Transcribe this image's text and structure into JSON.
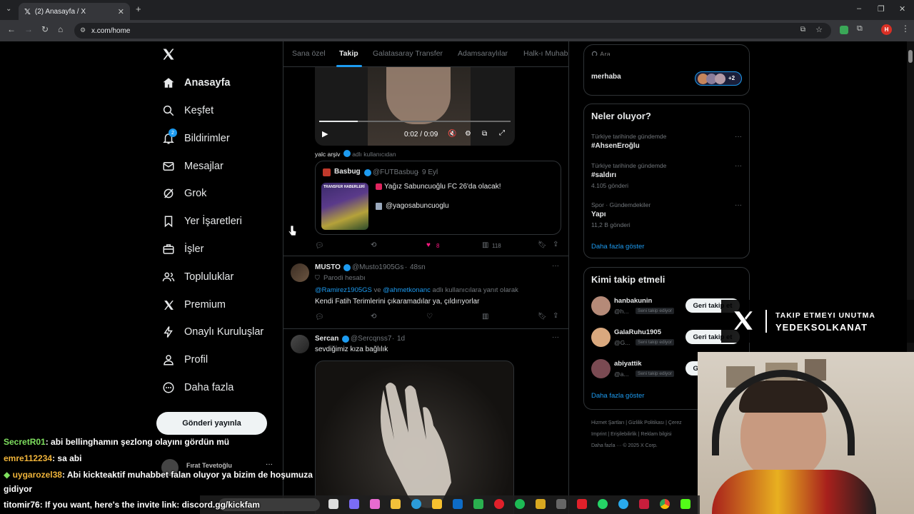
{
  "browser": {
    "tab_title": "(2) Anasayfa / X",
    "url": "x.com/home",
    "profile_initial": "H"
  },
  "nav": {
    "items": [
      {
        "label": "Anasayfa",
        "icon": "home-icon"
      },
      {
        "label": "Keşfet",
        "icon": "search-icon"
      },
      {
        "label": "Bildirimler",
        "icon": "bell-icon",
        "badge": "2"
      },
      {
        "label": "Mesajlar",
        "icon": "mail-icon"
      },
      {
        "label": "Grok",
        "icon": "grok-icon"
      },
      {
        "label": "Yer İşaretleri",
        "icon": "bookmark-icon"
      },
      {
        "label": "İşler",
        "icon": "briefcase-icon"
      },
      {
        "label": "Topluluklar",
        "icon": "people-icon"
      },
      {
        "label": "Premium",
        "icon": "x-logo-icon"
      },
      {
        "label": "Onaylı Kuruluşlar",
        "icon": "lightning-icon"
      },
      {
        "label": "Profil",
        "icon": "person-icon"
      },
      {
        "label": "Daha fazla",
        "icon": "more-circle-icon"
      }
    ],
    "post_button": "Gönderi yayınla",
    "account_name": "Fırat Tevetoğlu"
  },
  "tabs": [
    "Sana özel",
    "Takip",
    "Galatasaray Transfer",
    "Adamsaraylılar",
    "Halk-ı Muhab"
  ],
  "video": {
    "time": "0:02 / 0:09",
    "progress": 0.2
  },
  "repost_line": {
    "name": "yalc arşiv",
    "suffix": "adlı kullanıcıdan"
  },
  "quote": {
    "name": "Basbug",
    "handle": "@FUTBasbug",
    "date": "9 Eyl",
    "line1": "Yağız Sabuncuoğlu FC 26'da olacak!",
    "line2": "@yagosabuncuoglu",
    "thumb_label": "TRANSFER HABERLERİ"
  },
  "tweet1_actions": {
    "likes": "8",
    "views": "118"
  },
  "tweet2": {
    "name": "MUSTO",
    "handle": "@Musto1905Gs",
    "time": "48sn",
    "parody": "Parodi hesabı",
    "reply_to_1": "@Ramirez1905GS",
    "reply_and": "ve",
    "reply_to_2": "@ahmetkonanc",
    "reply_suffix": "adlı kullanıcılara yanıt olarak",
    "text": "Kendi Fatih Terimlerini çıkaramadılar ya, çıldırıyorlar"
  },
  "tweet3": {
    "name": "Sercan",
    "handle": "@Sercqnss7",
    "time": "1d",
    "text": "sevdiğimiz kıza bağlılık"
  },
  "right": {
    "search_placeholder": "Ara",
    "top_snippet": "merhaba",
    "top_badge": "+2",
    "trends_title": "Neler oluyor?",
    "trends": [
      {
        "category": "Türkiye tarihinde gündemde",
        "name": "#AhsenEroğlu",
        "count": ""
      },
      {
        "category": "Türkiye tarihinde gündemde",
        "name": "#saldırı",
        "count": "4.105 gönderi"
      },
      {
        "category": "Spor · Gündemdekiler",
        "name": "Yapı",
        "count": "11,2 B gönderi"
      }
    ],
    "show_more": "Daha fazla göster",
    "who_title": "Kimi takip etmeli",
    "who": [
      {
        "name": "hanbakunin",
        "handle": "@h...",
        "follows_you": "Seni takip ediyor",
        "button": "Geri takip et"
      },
      {
        "name": "GalaRuhu1905",
        "handle": "@G...",
        "follows_you": "Seni takip ediyor",
        "button": "Geri takip et"
      },
      {
        "name": "abiyattik",
        "handle": "@a...",
        "follows_you": "Seni takip ediyor",
        "button": "Geri takip et"
      }
    ],
    "who_show_more": "Daha fazla göster",
    "footer": {
      "line1": [
        "Hizmet Şartları",
        "Gizlilik Politikası",
        "Çerez"
      ],
      "line2": [
        "Imprint",
        "Erişilebilirlik",
        "Reklam bilgisi"
      ],
      "line3": "Daha fazla ··· © 2025 X Corp."
    }
  },
  "overlay": {
    "brand_line1": "TAKIP ETMEYI UNUTMA",
    "brand_line2": "YEDEKSOLKANAT"
  },
  "chat": [
    {
      "user": "SecretR01",
      "user_color": "#7fe05f",
      "text": ": abi bellinghamın şezlong olayını gördün mü"
    },
    {
      "user": "emre112234",
      "user_color": "#f0b43a",
      "text": ": sa abi"
    },
    {
      "user": "uygarozel38",
      "user_color": "#f0b43a",
      "text": ": Abi kickteaktif muhabbet falan oluyor ya bizim de hoşumuza",
      "continuation": "gidiyor"
    },
    {
      "user": "titomir76",
      "user_color": "#ffffff",
      "text": ": If you want, here's the invite link: discord.gg/kickfam"
    }
  ],
  "colors": {
    "accent": "#1d9bf0",
    "like": "#f91880",
    "border": "#2f3336",
    "muted": "#71767b"
  }
}
